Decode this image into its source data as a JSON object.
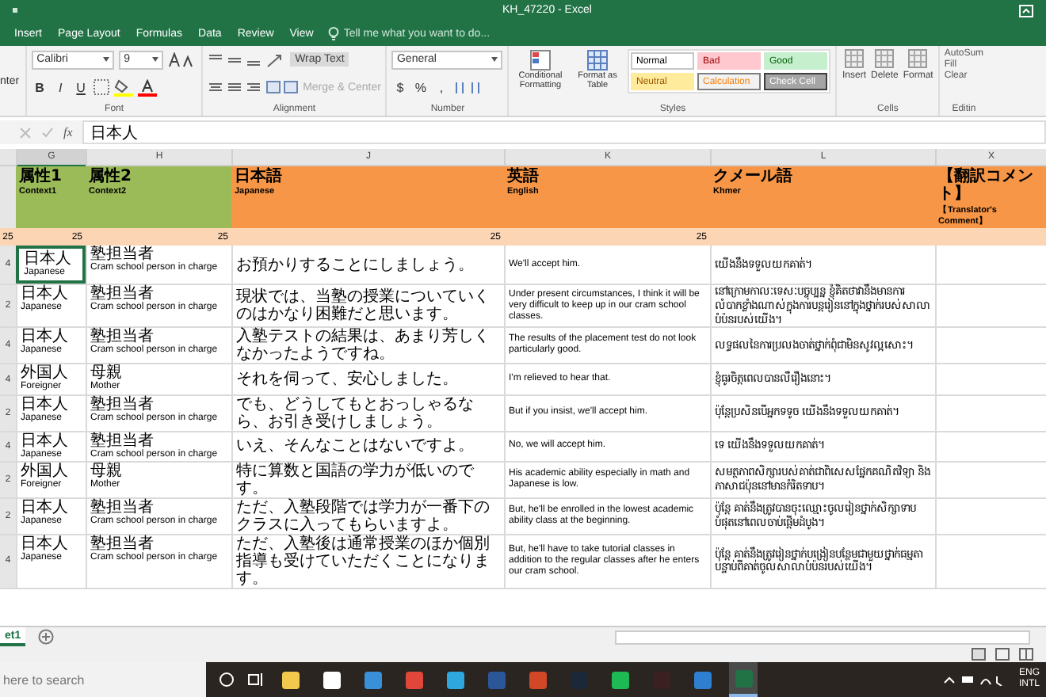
{
  "window": {
    "title": "KH_47220 - Excel"
  },
  "menu_tabs": [
    "Insert",
    "Page Layout",
    "Formulas",
    "Data",
    "Review",
    "View"
  ],
  "tell_me": {
    "placeholder": "Tell me what you want to do..."
  },
  "ribbon": {
    "clipboard_fragment": "nter",
    "font": {
      "name": "Calibri",
      "size": "9",
      "styles": [
        "B",
        "I",
        "U"
      ],
      "label": "Font"
    },
    "alignment": {
      "wrap": "Wrap Text",
      "merge": "Merge & Center",
      "label": "Alignment"
    },
    "number": {
      "format": "General",
      "symbols": [
        "$",
        "%",
        ","
      ],
      "label": "Number"
    },
    "styles": {
      "conditional": "Conditional Formatting",
      "format_table": "Format as Table",
      "cells": [
        {
          "name": "Normal",
          "kind": "normal"
        },
        {
          "name": "Bad",
          "kind": "bad"
        },
        {
          "name": "Good",
          "kind": "good"
        },
        {
          "name": "Neutral",
          "kind": "neutral"
        },
        {
          "name": "Calculation",
          "kind": "calculation"
        },
        {
          "name": "Check Cell",
          "kind": "check"
        }
      ],
      "label": "Styles"
    },
    "cells": {
      "buttons": [
        "Insert",
        "Delete",
        "Format"
      ],
      "label": "Cells"
    },
    "editing": {
      "buttons": [
        "AutoSum",
        "Fill",
        "Clear"
      ],
      "label": "Editin"
    }
  },
  "formula_bar": {
    "function_label": "fx",
    "value": "日本人"
  },
  "columns": [
    {
      "letter": "G",
      "selected": true
    },
    {
      "letter": "H",
      "selected": false
    },
    {
      "letter": "J",
      "selected": false
    },
    {
      "letter": "K",
      "selected": false
    },
    {
      "letter": "L",
      "selected": false
    },
    {
      "letter": "X",
      "selected": false
    }
  ],
  "header_row": [
    {
      "title": "属性1",
      "subtitle": "Context1",
      "kind": "context"
    },
    {
      "title": "属性2",
      "subtitle": "Context2",
      "kind": "context"
    },
    {
      "title": "日本語",
      "subtitle": "Japanese",
      "kind": "language"
    },
    {
      "title": "英語",
      "subtitle": "English",
      "kind": "language"
    },
    {
      "title": "クメール語",
      "subtitle": "Khmer",
      "kind": "language"
    },
    {
      "title": "【翻訳コメント】",
      "subtitle": "【Translator's Comment】",
      "kind": "language"
    }
  ],
  "width_row": {
    "row_number": "25",
    "cells": [
      "25",
      "25",
      "25",
      "25"
    ]
  },
  "rows": [
    {
      "row_number": "4",
      "selected": true,
      "context1": [
        "日本人",
        "Japanese"
      ],
      "context2": [
        "塾担当者",
        "Cram school person in charge"
      ],
      "japanese": "お預かりすることにしましょう。",
      "english": "We'll accept him.",
      "khmer": "យើងនឹងទទួលយកគាត់។"
    },
    {
      "row_number": "2",
      "selected": false,
      "context1": [
        "日本人",
        "Japanese"
      ],
      "context2": [
        "塾担当者",
        "Cram school person in charge"
      ],
      "japanese": "現状では、当塾の授業についていくのはかなり困難だと思います。",
      "english": "Under present circumstances, I think it will be very difficult to keep up in our cram school classes.",
      "khmer": "នៅក្រោមកាលៈទេសៈបច្ចុប្បន្ន ខ្ញុំគិតថាវានឹងមានការលំបាកខ្លាំងណាស់ក្នុងការបន្តរៀននៅក្នុងថ្នាក់របស់សាលាបំប៉នរបស់យើង។"
    },
    {
      "row_number": "4",
      "selected": false,
      "context1": [
        "日本人",
        "Japanese"
      ],
      "context2": [
        "塾担当者",
        "Cram school person in charge"
      ],
      "japanese": "入塾テストの結果は、あまり芳しくなかったようですね。",
      "english": "The results of the placement test do not look particularly good.",
      "khmer": "លទ្ធផលនៃការប្រលងចាត់ថ្នាក់ពុំជាមិនសូវល្អសោះ។"
    },
    {
      "row_number": "4",
      "selected": false,
      "context1": [
        "外国人",
        "Foreigner"
      ],
      "context2": [
        "母親",
        "Mother"
      ],
      "japanese": "それを伺って、安心しました。",
      "english": "I'm relieved to hear that.",
      "khmer": "ខ្ញុំធូរចិត្តពេលបានលឺរឿងនោះ។"
    },
    {
      "row_number": "2",
      "selected": false,
      "context1": [
        "日本人",
        "Japanese"
      ],
      "context2": [
        "塾担当者",
        "Cram school person in charge"
      ],
      "japanese": "でも、どうしてもとおっしゃるなら、お引き受けしましょう。",
      "english": "But if you insist, we'll accept him.",
      "khmer": "ប៉ុន្តែប្រសិនបើអ្នកទទូច យើងនឹងទទួលយកគាត់។"
    },
    {
      "row_number": "4",
      "selected": false,
      "context1": [
        "日本人",
        "Japanese"
      ],
      "context2": [
        "塾担当者",
        "Cram school person in charge"
      ],
      "japanese": "いえ、そんなことはないですよ。",
      "english": "No, we will accept him.",
      "khmer": "ទេ យើងនឹងទទួលយកគាត់។"
    },
    {
      "row_number": "2",
      "selected": false,
      "context1": [
        "外国人",
        "Foreigner"
      ],
      "context2": [
        "母親",
        "Mother"
      ],
      "japanese": "特に算数と国語の学力が低いのです。",
      "english": "His academic ability especially in math and Japanese is low.",
      "khmer": "សមត្ថភាពសិក្សារបស់គាត់ជាពិសេសផ្នែកគណិតវិទ្យា និងភាសាជប៉ុននៅមានកំរិតទាប។"
    },
    {
      "row_number": "2",
      "selected": false,
      "context1": [
        "日本人",
        "Japanese"
      ],
      "context2": [
        "塾担当者",
        "Cram school person in charge"
      ],
      "japanese": "ただ、入塾段階では学力が一番下のクラスに入ってもらいますよ。",
      "english": "But, he'll be enrolled in the lowest academic ability class at the beginning.",
      "khmer": "ប៉ុន្តែ គាត់នឹងត្រូវបានចុះឈ្មោះចូលរៀនថ្នាក់សិក្សាទាបបំផុតនៅពេលចាប់ផ្ដើមដំបូង។"
    },
    {
      "row_number": "4",
      "selected": false,
      "context1": [
        "日本人",
        "Japanese"
      ],
      "context2": [
        "塾担当者",
        "Cram school person in charge"
      ],
      "japanese": "ただ、入塾後は通常授業のほか個別指導も受けていただくことになります。",
      "english": "But, he'll have to take tutorial classes in addition to the regular classes after he enters our cram school.",
      "khmer": "ប៉ុន្តែ គាត់នឹងត្រូវរៀនថ្នាក់បង្រៀនបន្ថែមជាមួយថ្នាក់ធម្មតាបន្ទាប់ពីគាត់ចូលសាលាបំប៉នរបស់យើង។"
    }
  ],
  "sheet_tabs": [
    {
      "label": "et1",
      "selected": true
    }
  ],
  "taskbar": {
    "search": {
      "placeholder": "here to search"
    },
    "language": [
      "ENG",
      "INTL"
    ]
  }
}
